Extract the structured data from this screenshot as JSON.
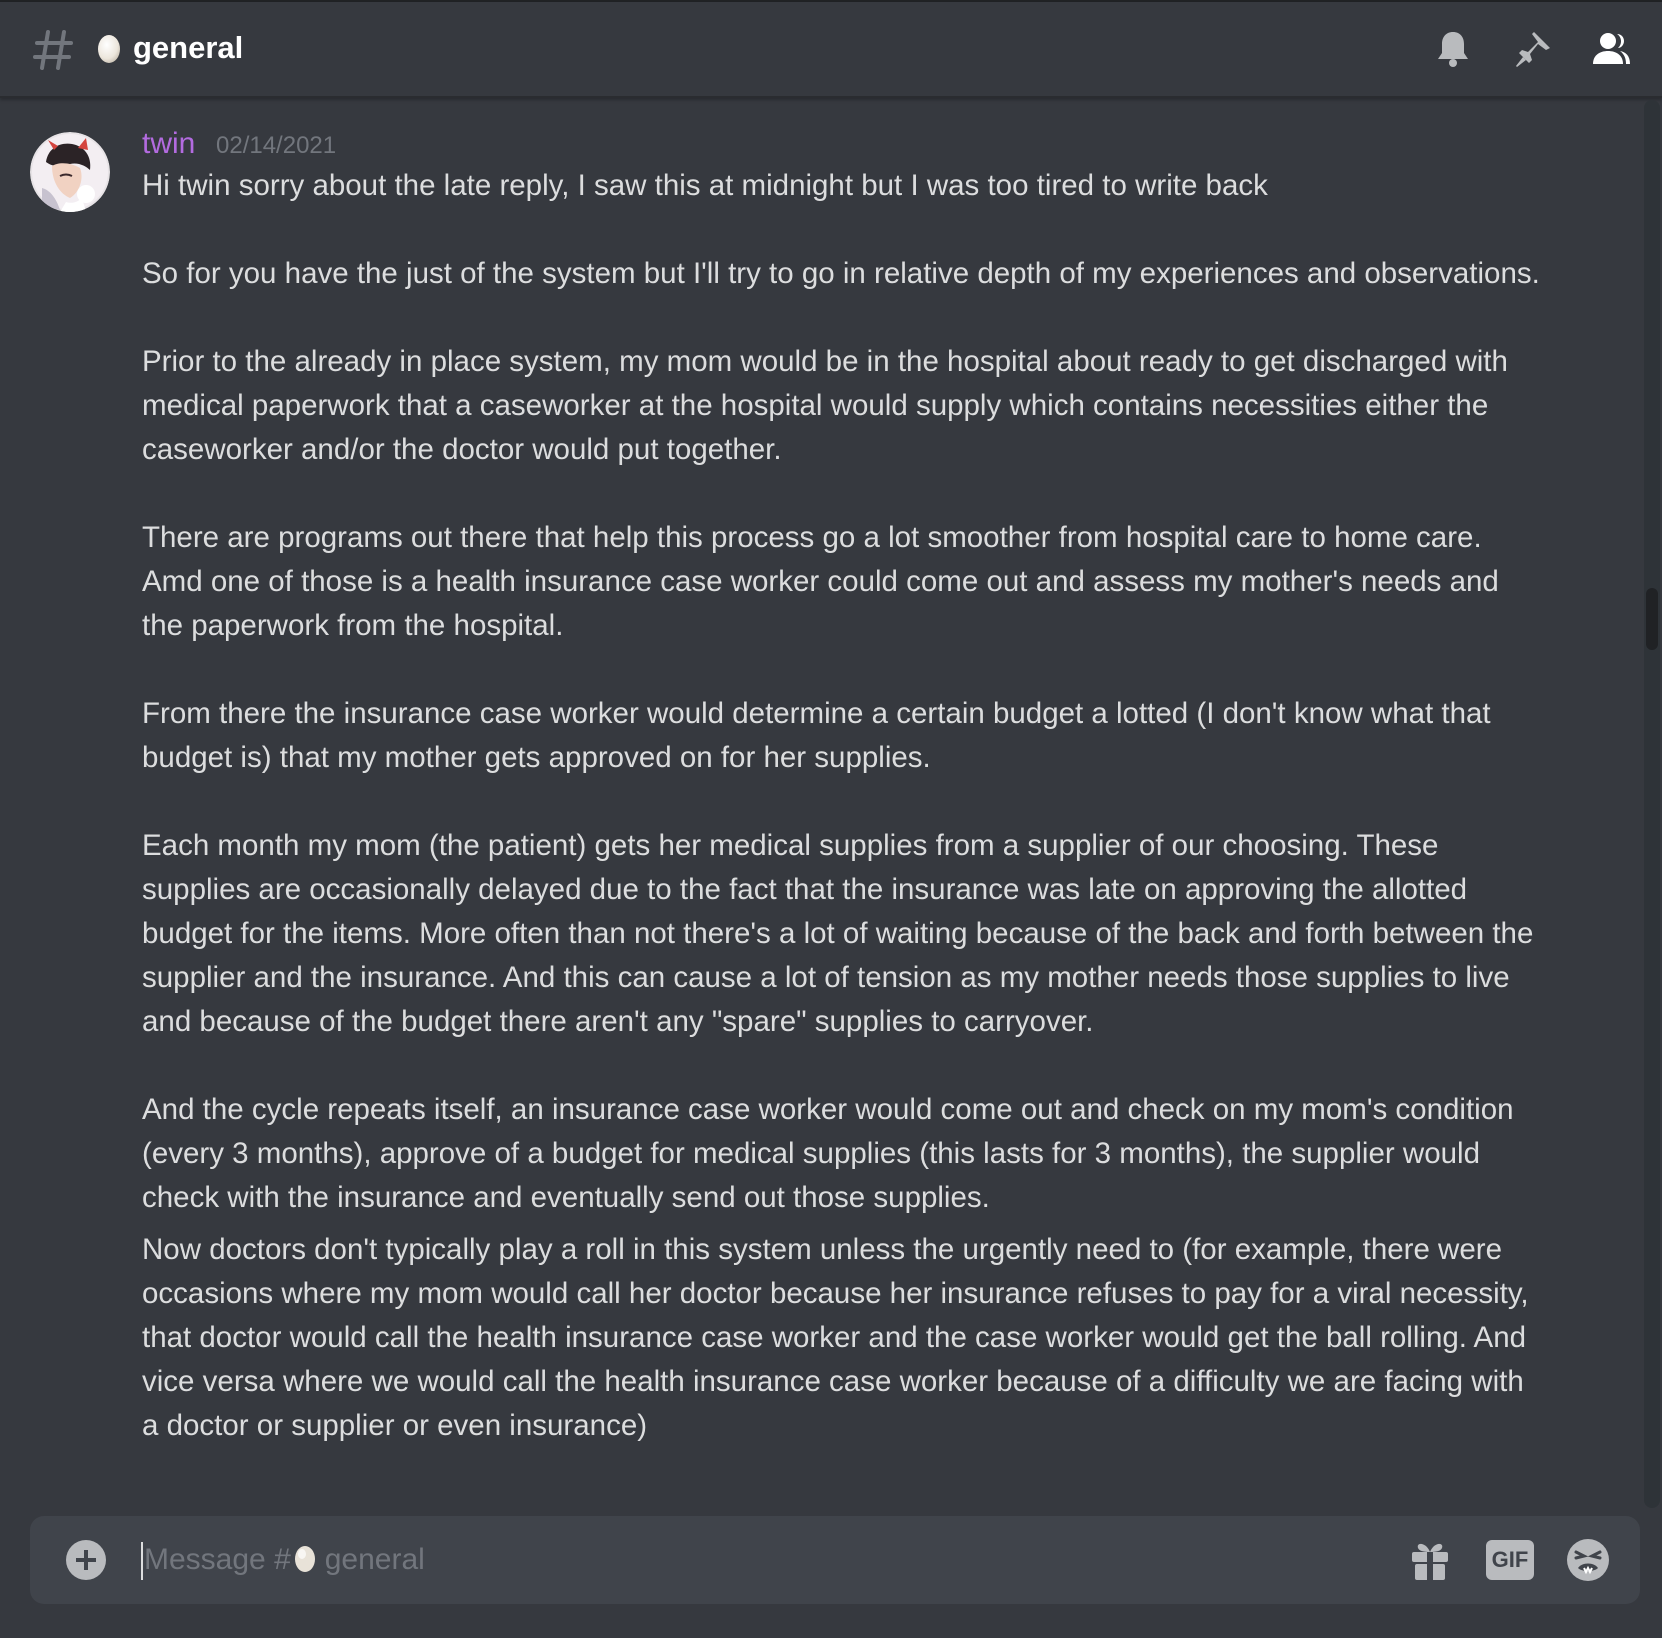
{
  "header": {
    "channel_name": "general",
    "icons": [
      "hash-icon",
      "egg-icon",
      "bell-icon",
      "pin-icon",
      "members-icon"
    ]
  },
  "message": {
    "author": "twin",
    "timestamp": "02/14/2021",
    "author_color": "#b36be0",
    "paragraphs": [
      "Hi twin sorry about the late reply, I saw this at midnight but I was too tired to write back",
      "So for you have the just of the system but I'll try to go in relative depth of my experiences and observations.",
      "Prior to the already in place system, my mom would be in the hospital about ready to get discharged with medical paperwork that a caseworker at the hospital would supply which contains necessities either the caseworker and/or the doctor would put together.",
      "There are programs out there that help this process go a lot smoother from hospital care to home care. Amd one of those is a health insurance case worker could come out and assess my mother's needs and the paperwork from the hospital.",
      "From there the insurance case worker would determine a certain budget a lotted (I don't know what that budget is) that my mother gets approved on for her supplies.",
      "Each month my mom (the patient) gets her medical supplies from a supplier of our choosing. These supplies are occasionally delayed due to the fact that the insurance was late on approving the allotted budget for the items. More often than not there's a lot of waiting because of the back and forth between the supplier and the insurance. And this can cause a lot of tension as my mother needs those supplies to live and because of the budget there aren't any \"spare\" supplies to carryover.",
      "And the cycle repeats itself, an insurance case worker would come out and check on my mom's condition (every 3 months), approve of a budget for medical supplies (this lasts for 3 months), the supplier would check with the insurance and eventually send out those supplies.",
      "Now doctors don't typically play a roll in this system unless the urgently need to (for example, there were occasions where my mom would call her doctor because her insurance refuses to pay for a viral necessity, that doctor would call the health insurance case worker and the case worker would get the ball rolling. And vice versa where we would call the health insurance case worker because of a difficulty we are facing with a doctor or supplier or even insurance)"
    ]
  },
  "composer": {
    "placeholder_prefix": "Message #",
    "placeholder_channel": "general",
    "gif_label": "GIF"
  },
  "colors": {
    "background": "#36393f",
    "composer": "#40444b",
    "text": "#dcddde",
    "muted": "#72767d"
  }
}
